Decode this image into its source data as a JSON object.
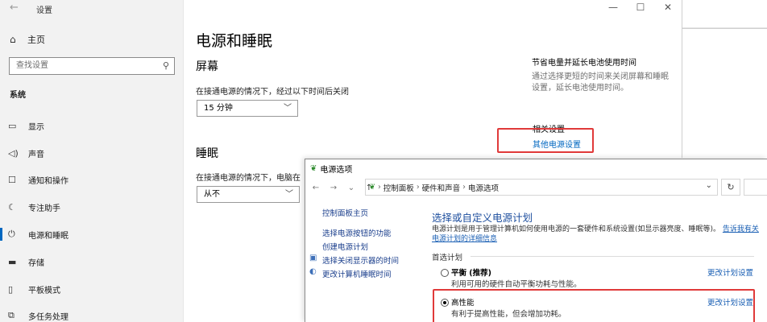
{
  "settings": {
    "title": "设置",
    "back_glyph": "←",
    "window_controls": [
      "—",
      "☐",
      "✕"
    ],
    "home_label": "主页",
    "search_placeholder": "查找设置",
    "section_label": "系统",
    "nav_items": [
      {
        "label": "显示",
        "icon": "display-icon"
      },
      {
        "label": "声音",
        "icon": "speaker-icon"
      },
      {
        "label": "通知和操作",
        "icon": "notification-icon"
      },
      {
        "label": "专注助手",
        "icon": "moon-icon"
      },
      {
        "label": "电源和睡眠",
        "icon": "power-icon"
      },
      {
        "label": "存储",
        "icon": "storage-icon"
      },
      {
        "label": "平板模式",
        "icon": "tablet-icon"
      },
      {
        "label": "多任务处理",
        "icon": "multitask-icon"
      }
    ],
    "active_item": "电源和睡眠",
    "page_title": "电源和睡眠",
    "screen_heading": "屏幕",
    "screen_caption": "在接通电源的情况下，经过以下时间后关闭",
    "screen_value": "15 分钟",
    "sleep_heading": "睡眠",
    "sleep_caption": "在接通电源的情况下，电脑在",
    "sleep_value": "从不",
    "battery_title": "节省电量并延长电池使用时间",
    "battery_desc": "通过选择更短的时间来关闭屏幕和睡眠设置，延长电池使用时间。",
    "related_title": "相关设置",
    "related_link": "其他电源设置"
  },
  "control_panel": {
    "title": "电源选项",
    "breadcrumbs": [
      "控制面板",
      "硬件和声音",
      "电源选项"
    ],
    "left_links": [
      {
        "label": "控制面板主页"
      },
      {
        "label": "选择电源按钮的功能"
      },
      {
        "label": "创建电源计划"
      },
      {
        "label": "选择关闭显示器的时间"
      },
      {
        "label": "更改计算机睡眠时间"
      }
    ],
    "heading": "选择或自定义电源计划",
    "description": "电源计划是用于管理计算机如何使用电源的一套硬件和系统设置(如显示器亮度、睡眠等)。",
    "description_link": "告诉我有关电源计划的详细信息",
    "group_label": "首选计划",
    "plans": [
      {
        "name": "平衡 (推荐)",
        "desc": "利用可用的硬件自动平衡功耗与性能。",
        "link": "更改计划设置",
        "checked": false
      },
      {
        "name": "高性能",
        "desc": "有利于提高性能，但会增加功耗。",
        "link": "更改计划设置",
        "checked": true
      }
    ]
  },
  "colors": {
    "accent": "#0067c0",
    "highlight_box": "#e03a3a",
    "cp_heading": "#1d4e9e"
  }
}
